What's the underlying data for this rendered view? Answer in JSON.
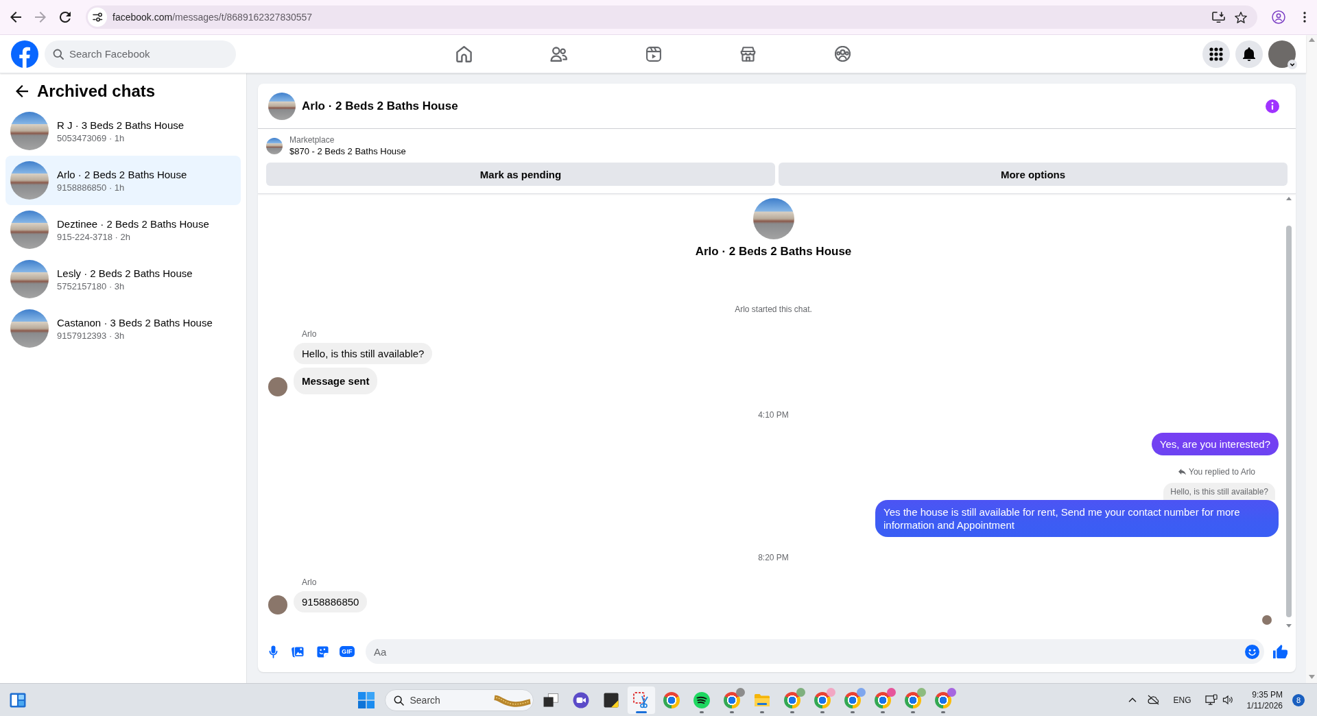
{
  "browser": {
    "nav_buttons": [
      {
        "kind": "back",
        "disabled": false
      },
      {
        "kind": "forward",
        "disabled": true
      },
      {
        "kind": "reload",
        "disabled": false
      }
    ],
    "url_host": "facebook.com",
    "url_path": "/messages/t/8689162327830557"
  },
  "header": {
    "search_placeholder": "Search Facebook",
    "nav": [
      {
        "kind": "home",
        "selected": false
      },
      {
        "kind": "friends",
        "selected": false
      },
      {
        "kind": "video",
        "selected": false
      },
      {
        "kind": "marketplace",
        "selected": false
      },
      {
        "kind": "groups",
        "selected": false
      }
    ]
  },
  "sidebar": {
    "title": "Archived chats",
    "chats": [
      {
        "name": "R J · 3 Beds 2 Baths House",
        "preview": "5053473069 · 1h",
        "selected": false
      },
      {
        "name": "Arlo · 2 Beds 2 Baths House",
        "preview": "9158886850 · 1h",
        "selected": true
      },
      {
        "name": "Deztinee · 2 Beds 2 Baths House",
        "preview": "915-224-3718 · 2h",
        "selected": false
      },
      {
        "name": "Lesly · 2 Beds 2 Baths House",
        "preview": "5752157180 · 3h",
        "selected": false
      },
      {
        "name": "Castanon · 3 Beds 2 Baths House",
        "preview": "9157912393 · 3h",
        "selected": false
      }
    ]
  },
  "conversation": {
    "title": "Arlo · 2 Beds 2 Baths House",
    "listing": {
      "label": "Marketplace",
      "text": "$870 - 2 Beds 2 Baths House"
    },
    "actions": [
      "Mark as pending",
      "More options"
    ],
    "intro_title": "Arlo · 2 Beds 2 Baths House",
    "messages": [
      {
        "kind": "notice",
        "text": "Arlo started this chat."
      },
      {
        "kind": "incoming",
        "sender": "Arlo",
        "bubbles": [
          {
            "text": "Hello, is this still available?",
            "bold": false
          },
          {
            "text": "Message sent",
            "bold": true
          }
        ]
      },
      {
        "kind": "time",
        "text": "4:10 PM"
      },
      {
        "kind": "outgoing",
        "bubbles": [
          {
            "text": "Yes, are you interested?",
            "bold": false
          }
        ]
      },
      {
        "kind": "reply",
        "note": "You replied to Arlo",
        "quote": "Hello, is this still available?",
        "text": "Yes the house is still available for rent, Send me your contact number for more information and Appointment"
      },
      {
        "kind": "time",
        "text": "8:20 PM"
      },
      {
        "kind": "incoming",
        "sender": "Arlo",
        "bubbles": [
          {
            "text": "9158886850",
            "bold": false
          }
        ]
      }
    ],
    "composer": {
      "gif_label": "GIF",
      "placeholder": "Aa"
    }
  },
  "taskbar": {
    "search_placeholder": "Search",
    "apps": [
      {
        "kind": "task-view",
        "running": false,
        "selected": false
      },
      {
        "kind": "meet",
        "running": false,
        "selected": false
      },
      {
        "kind": "sticky-notes",
        "running": false,
        "selected": false
      },
      {
        "kind": "snipping-tool",
        "running": true,
        "selected": true
      },
      {
        "kind": "chrome",
        "running": false,
        "selected": false
      },
      {
        "kind": "spotify",
        "running": true,
        "selected": false
      },
      {
        "kind": "chrome-profile",
        "color": "#8c8c8c",
        "running": true,
        "selected": false
      },
      {
        "kind": "file-explorer",
        "running": true,
        "selected": false
      },
      {
        "kind": "chrome-profile",
        "color": "#7fb07e",
        "running": true,
        "selected": false
      },
      {
        "kind": "chrome-profile",
        "color": "#f2a7c3",
        "running": true,
        "selected": false
      },
      {
        "kind": "chrome-profile",
        "color": "#7ea6ee",
        "running": true,
        "selected": false
      },
      {
        "kind": "chrome-profile",
        "color": "#e6559a",
        "running": true,
        "selected": false
      },
      {
        "kind": "chrome-profile",
        "color": "#8dbb7f",
        "running": true,
        "selected": false
      },
      {
        "kind": "chrome-profile",
        "color": "#a666e0",
        "running": true,
        "selected": false
      }
    ],
    "language": "ENG",
    "time": "9:35 PM",
    "date": "1/11/2026",
    "notification_count": "8"
  }
}
